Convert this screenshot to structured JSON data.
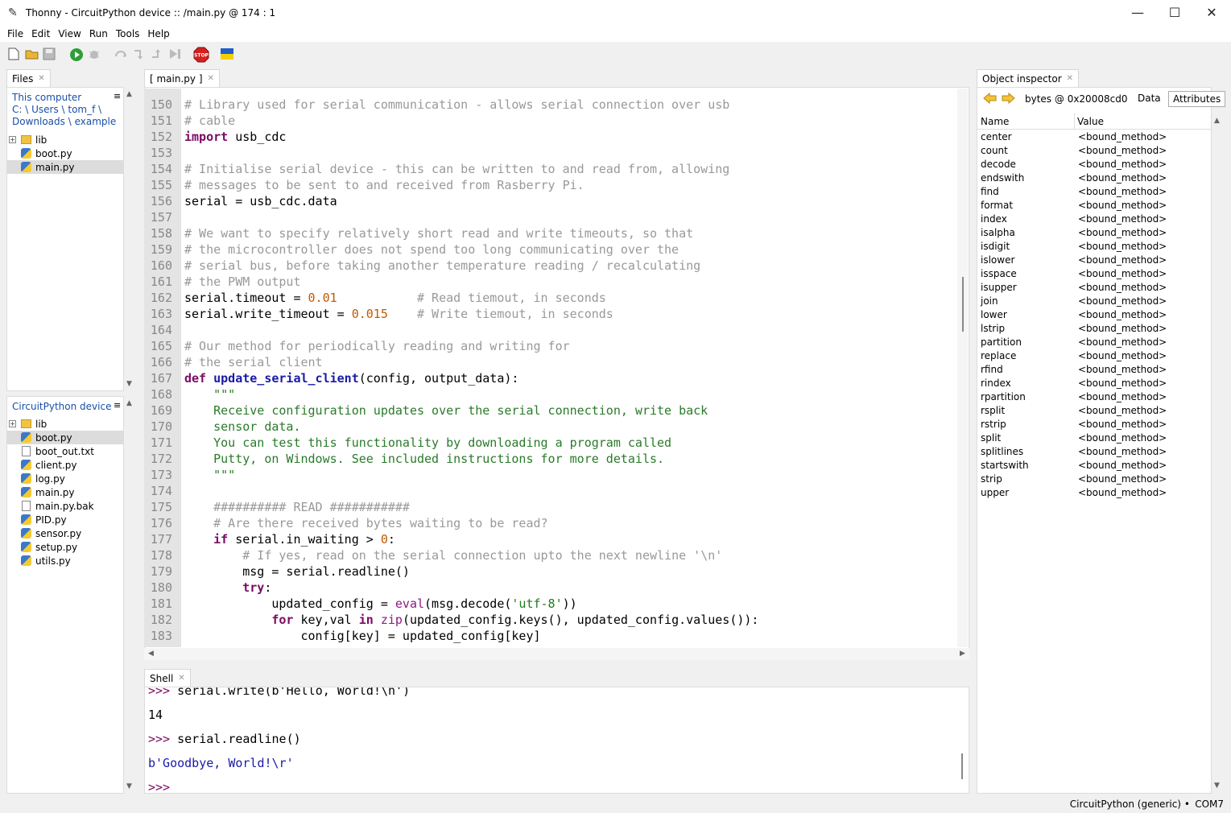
{
  "window": {
    "title": "Thonny  -  CircuitPython device :: /main.py  @  174 : 1",
    "minimize": "—",
    "maximize": "☐",
    "close": "✕"
  },
  "menu": [
    "File",
    "Edit",
    "View",
    "Run",
    "Tools",
    "Help"
  ],
  "toolbar": {
    "icons": [
      "new-file-icon",
      "open-file-icon",
      "save-icon",
      "run-icon",
      "debug-icon",
      "step-over-icon",
      "step-into-icon",
      "step-out-icon",
      "resume-icon",
      "stop-icon",
      "ukraine-flag-icon"
    ],
    "stop_label": "STOP"
  },
  "files_panel": {
    "tab": "Files",
    "computer_header": "This computer",
    "computer_path": [
      "C:",
      "Users",
      "tom_f",
      "Downloads",
      "example"
    ],
    "computer_items": [
      {
        "name": "lib",
        "type": "folder"
      },
      {
        "name": "boot.py",
        "type": "py"
      },
      {
        "name": "main.py",
        "type": "py",
        "selected": true
      }
    ],
    "device_header": "CircuitPython device",
    "device_items": [
      {
        "name": "lib",
        "type": "folder"
      },
      {
        "name": "boot.py",
        "type": "py",
        "selected": true
      },
      {
        "name": "boot_out.txt",
        "type": "txt"
      },
      {
        "name": "client.py",
        "type": "py"
      },
      {
        "name": "log.py",
        "type": "py"
      },
      {
        "name": "main.py",
        "type": "py"
      },
      {
        "name": "main.py.bak",
        "type": "txt"
      },
      {
        "name": "PID.py",
        "type": "py"
      },
      {
        "name": "sensor.py",
        "type": "py"
      },
      {
        "name": "setup.py",
        "type": "py"
      },
      {
        "name": "utils.py",
        "type": "py"
      }
    ]
  },
  "editor": {
    "tab": "[ main.py ]",
    "lines": [
      {
        "n": "150",
        "html": "<span class='cm'># Library used for serial communication - allows serial connection over usb</span>"
      },
      {
        "n": "151",
        "html": "<span class='cm'># cable</span>"
      },
      {
        "n": "152",
        "html": "<span class='kw'>import</span> usb_cdc"
      },
      {
        "n": "153",
        "html": ""
      },
      {
        "n": "154",
        "html": "<span class='cm'># Initialise serial device - this can be written to and read from, allowing</span>"
      },
      {
        "n": "155",
        "html": "<span class='cm'># messages to be sent to and received from Rasberry Pi.</span>"
      },
      {
        "n": "156",
        "html": "serial = usb_cdc.data"
      },
      {
        "n": "157",
        "html": ""
      },
      {
        "n": "158",
        "html": "<span class='cm'># We want to specify relatively short read and write timeouts, so that</span>"
      },
      {
        "n": "159",
        "html": "<span class='cm'># the microcontroller does not spend too long communicating over the</span>"
      },
      {
        "n": "160",
        "html": "<span class='cm'># serial bus, before taking another temperature reading / recalculating</span>"
      },
      {
        "n": "161",
        "html": "<span class='cm'># the PWM output</span>"
      },
      {
        "n": "162",
        "html": "serial.timeout = <span class='num'>0.01</span>           <span class='cm'># Read tiemout, in seconds</span>"
      },
      {
        "n": "163",
        "html": "serial.write_timeout = <span class='num'>0.015</span>    <span class='cm'># Write tiemout, in seconds</span>"
      },
      {
        "n": "164",
        "html": ""
      },
      {
        "n": "165",
        "html": "<span class='cm'># Our method for periodically reading and writing for</span>"
      },
      {
        "n": "166",
        "html": "<span class='cm'># the serial client</span>"
      },
      {
        "n": "167",
        "html": "<span class='kw'>def</span> <span class='fn'>update_serial_client</span>(config, output_data):"
      },
      {
        "n": "168",
        "html": "    <span class='doc'>\"\"\"</span>"
      },
      {
        "n": "169",
        "html": "<span class='doc'>    Receive configuration updates over the serial connection, write back</span>"
      },
      {
        "n": "170",
        "html": "<span class='doc'>    sensor data.</span>"
      },
      {
        "n": "171",
        "html": "<span class='doc'>    You can test this functionality by downloading a program called</span>"
      },
      {
        "n": "172",
        "html": "<span class='doc'>    Putty, on Windows. See included instructions for more details.</span>"
      },
      {
        "n": "173",
        "html": "<span class='doc'>    \"\"\"</span>"
      },
      {
        "n": "174",
        "html": ""
      },
      {
        "n": "175",
        "html": "    <span class='cm'>########## READ ###########</span>"
      },
      {
        "n": "176",
        "html": "    <span class='cm'># Are there received bytes waiting to be read?</span>"
      },
      {
        "n": "177",
        "html": "    <span class='kw'>if</span> serial.in_waiting > <span class='num'>0</span>:"
      },
      {
        "n": "178",
        "html": "        <span class='cm'># If yes, read on the serial connection upto the next newline '\\n'</span>"
      },
      {
        "n": "179",
        "html": "        msg = serial.readline()"
      },
      {
        "n": "180",
        "html": "        <span class='kw'>try</span>:"
      },
      {
        "n": "181",
        "html": "            updated_config = <span class='bi'>eval</span>(msg.decode(<span class='str'>'utf-8'</span>))"
      },
      {
        "n": "182",
        "html": "            <span class='kw'>for</span> key,val <span class='kw'>in</span> <span class='bi'>zip</span>(updated_config.keys(), updated_config.values()):"
      },
      {
        "n": "183",
        "html": "                config[key] = updated_config[key]"
      }
    ]
  },
  "shell": {
    "tab": "Shell",
    "lines": [
      {
        "type": "cmd",
        "prompt": ">>>",
        "text": " serial.write(b'Hello, World!\\n')"
      },
      {
        "type": "out",
        "text": "14"
      },
      {
        "type": "cmd",
        "prompt": ">>>",
        "text": " serial.readline()"
      },
      {
        "type": "out",
        "text": "b'Goodbye, World!\\r'"
      },
      {
        "type": "cmd",
        "prompt": ">>>",
        "text": ""
      }
    ]
  },
  "inspector": {
    "tab": "Object inspector",
    "object_label": "bytes @ 0x20008cd0",
    "tabs": [
      "Data",
      "Attributes"
    ],
    "columns": [
      "Name",
      "Value"
    ],
    "rows": [
      [
        "center",
        "<bound_method>"
      ],
      [
        "count",
        "<bound_method>"
      ],
      [
        "decode",
        "<bound_method>"
      ],
      [
        "endswith",
        "<bound_method>"
      ],
      [
        "find",
        "<bound_method>"
      ],
      [
        "format",
        "<bound_method>"
      ],
      [
        "index",
        "<bound_method>"
      ],
      [
        "isalpha",
        "<bound_method>"
      ],
      [
        "isdigit",
        "<bound_method>"
      ],
      [
        "islower",
        "<bound_method>"
      ],
      [
        "isspace",
        "<bound_method>"
      ],
      [
        "isupper",
        "<bound_method>"
      ],
      [
        "join",
        "<bound_method>"
      ],
      [
        "lower",
        "<bound_method>"
      ],
      [
        "lstrip",
        "<bound_method>"
      ],
      [
        "partition",
        "<bound_method>"
      ],
      [
        "replace",
        "<bound_method>"
      ],
      [
        "rfind",
        "<bound_method>"
      ],
      [
        "rindex",
        "<bound_method>"
      ],
      [
        "rpartition",
        "<bound_method>"
      ],
      [
        "rsplit",
        "<bound_method>"
      ],
      [
        "rstrip",
        "<bound_method>"
      ],
      [
        "split",
        "<bound_method>"
      ],
      [
        "splitlines",
        "<bound_method>"
      ],
      [
        "startswith",
        "<bound_method>"
      ],
      [
        "strip",
        "<bound_method>"
      ],
      [
        "upper",
        "<bound_method>"
      ]
    ]
  },
  "status": {
    "interpreter": "CircuitPython (generic)",
    "separator": "•",
    "port": "COM7"
  },
  "colors": {
    "comment": "#999999",
    "keyword": "#7a0a64",
    "string": "#1f7a1f",
    "number": "#c05a00"
  }
}
